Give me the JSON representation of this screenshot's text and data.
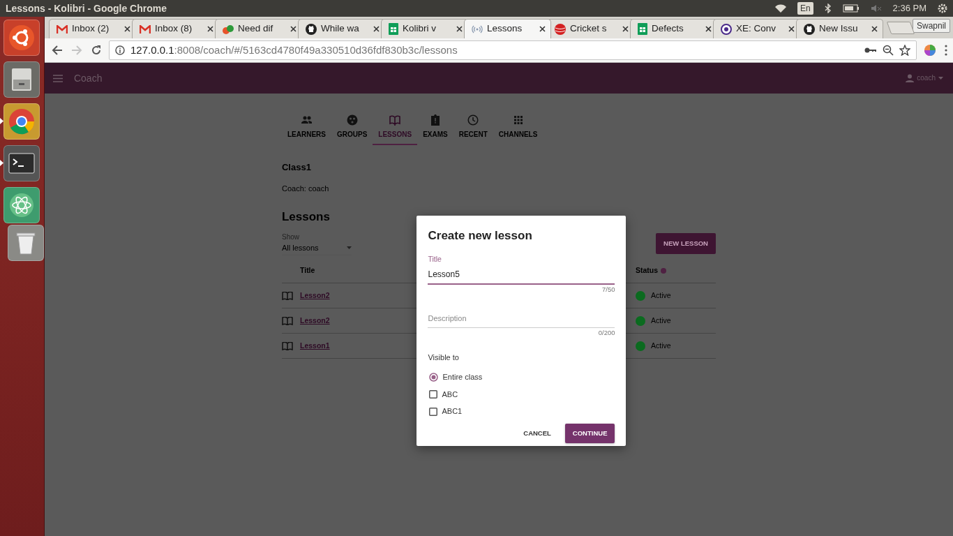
{
  "desktop": {
    "window_title": "Lessons - Kolibri - Google Chrome",
    "keyboard_layout": "En",
    "clock": "2:36 PM"
  },
  "launcher": {
    "items": [
      {
        "kind": "ubuntu",
        "running": false
      },
      {
        "kind": "files",
        "running": false
      },
      {
        "kind": "chrome",
        "running": true
      },
      {
        "kind": "terminal",
        "running": true
      },
      {
        "kind": "atom",
        "running": false
      },
      {
        "kind": "trash",
        "running": false
      }
    ]
  },
  "browser": {
    "tabs": [
      {
        "kind": "mail",
        "label": "Inbox (2)",
        "selected": false
      },
      {
        "kind": "mail",
        "label": "Inbox (8)",
        "selected": false
      },
      {
        "kind": "blob",
        "label": "Need dif",
        "selected": false
      },
      {
        "kind": "octocat",
        "label": "While wa",
        "selected": false
      },
      {
        "kind": "sheet",
        "label": "Kolibri v",
        "selected": false
      },
      {
        "kind": "signal",
        "label": "Lessons",
        "selected": true
      },
      {
        "kind": "ball",
        "label": "Cricket s",
        "selected": false
      },
      {
        "kind": "sheet",
        "label": "Defects",
        "selected": false
      },
      {
        "kind": "xe",
        "label": "XE: Conv",
        "selected": false
      },
      {
        "kind": "octocat",
        "label": "New Issu",
        "selected": false
      }
    ],
    "profile": "Swapnil",
    "address": {
      "host": "127.0.0.1",
      "rest": ":8008/coach/#/5163cd4780f49a330510d36fdf830b3c/lessons"
    },
    "forward_disabled": true
  },
  "app": {
    "header": {
      "title": "Coach",
      "user": "coach"
    },
    "nav": [
      {
        "kind": "people",
        "label": "LEARNERS",
        "selected": false
      },
      {
        "kind": "groups",
        "label": "GROUPS",
        "selected": false
      },
      {
        "kind": "book",
        "label": "LESSONS",
        "selected": true
      },
      {
        "kind": "clipboard",
        "label": "EXAMS",
        "selected": false
      },
      {
        "kind": "clock",
        "label": "RECENT",
        "selected": false
      },
      {
        "kind": "grid",
        "label": "CHANNELS",
        "selected": false
      }
    ],
    "class_name": "Class1",
    "coach_line": "Coach: coach",
    "section_title": "Lessons",
    "filter": {
      "label": "Show",
      "value": "All lessons"
    },
    "new_button": "NEW LESSON",
    "table": {
      "columns": [
        "Title",
        "Status"
      ],
      "rows": [
        {
          "title": "Lesson2",
          "status": "Active",
          "color": "#0b6b1f"
        },
        {
          "title": "Lesson2",
          "status": "Active",
          "color": "#0b6b1f"
        },
        {
          "title": "Lesson1",
          "status": "Active",
          "color": "#0b6b1f"
        }
      ]
    }
  },
  "dialog": {
    "title": "Create new lesson",
    "title_field": {
      "label": "Title",
      "value": "Lesson5",
      "counter": "7/50",
      "focused": true
    },
    "description_field": {
      "placeholder": "Description",
      "counter": "0/200",
      "focused": false
    },
    "visible_to": "Visible to",
    "options": [
      {
        "kind": "radio",
        "label": "Entire class",
        "checked": true
      },
      {
        "kind": "checkbox",
        "label": "ABC",
        "checked": false
      },
      {
        "kind": "checkbox",
        "label": "ABC1",
        "checked": false
      }
    ],
    "buttons": [
      {
        "kind": "flat",
        "label": "CANCEL"
      },
      {
        "kind": "raised",
        "label": "CONTINUE"
      }
    ]
  }
}
